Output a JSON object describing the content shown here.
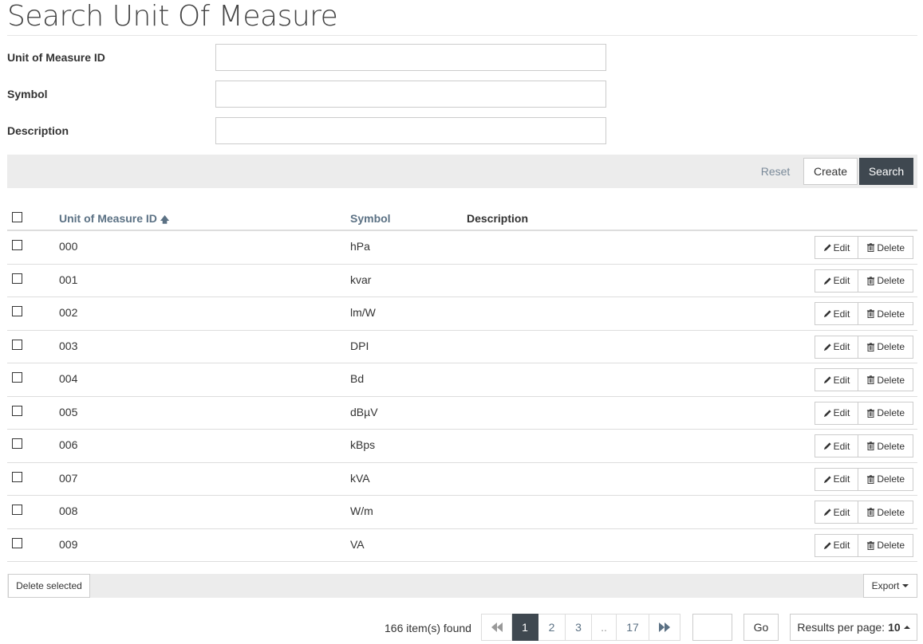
{
  "page": {
    "title": "Search Unit Of Measure"
  },
  "form": {
    "fields": [
      {
        "label": "Unit of Measure ID",
        "value": "",
        "placeholder": ""
      },
      {
        "label": "Symbol",
        "value": "",
        "placeholder": ""
      },
      {
        "label": "Description",
        "value": "",
        "placeholder": ""
      }
    ],
    "reset_label": "Reset",
    "create_label": "Create",
    "search_label": "Search"
  },
  "table": {
    "columns": {
      "id": "Unit of Measure ID",
      "symbol": "Symbol",
      "description": "Description"
    },
    "sort_icon": "arrow-up-icon",
    "edit_label": "Edit",
    "delete_label": "Delete",
    "rows": [
      {
        "id": "000",
        "symbol": "hPa",
        "description": ""
      },
      {
        "id": "001",
        "symbol": "kvar",
        "description": ""
      },
      {
        "id": "002",
        "symbol": "lm/W",
        "description": ""
      },
      {
        "id": "003",
        "symbol": "DPI",
        "description": ""
      },
      {
        "id": "004",
        "symbol": "Bd",
        "description": ""
      },
      {
        "id": "005",
        "symbol": "dBµV",
        "description": ""
      },
      {
        "id": "006",
        "symbol": "kBps",
        "description": ""
      },
      {
        "id": "007",
        "symbol": "kVA",
        "description": ""
      },
      {
        "id": "008",
        "symbol": "W/m",
        "description": ""
      },
      {
        "id": "009",
        "symbol": "VA",
        "description": ""
      }
    ]
  },
  "bottom": {
    "delete_selected_label": "Delete selected",
    "export_label": "Export"
  },
  "pagination": {
    "items_found": "166 item(s) found",
    "pages": [
      "1",
      "2",
      "3",
      "..",
      "17"
    ],
    "active_page": "1",
    "go_label": "Go",
    "results_per_page_label": "Results per page:",
    "results_per_page_value": "10"
  },
  "colors": {
    "accent_dark": "#3f4850",
    "link": "#5b7184",
    "bar_bg": "#ececec"
  }
}
